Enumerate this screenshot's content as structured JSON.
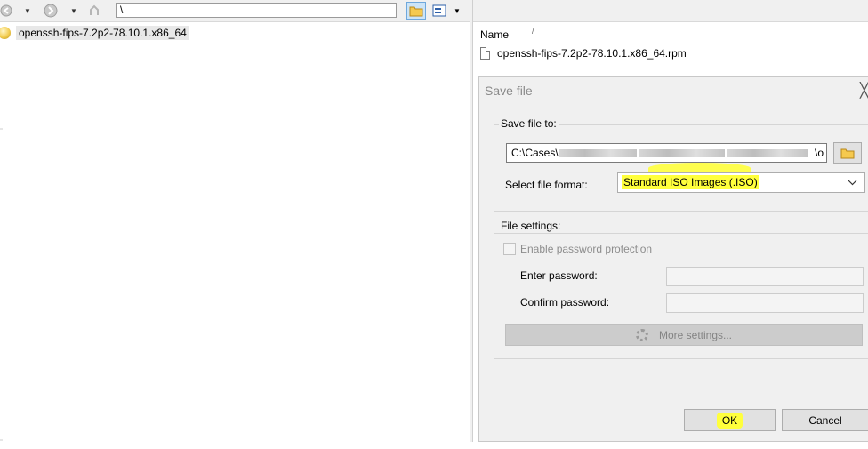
{
  "toolbar": {
    "address": "\\",
    "icons": [
      "back-icon",
      "forward-icon",
      "parent-folder-icon",
      "folder-icon",
      "view-icon"
    ]
  },
  "tree": {
    "items": [
      {
        "label": "openssh-fips-7.2p2-78.10.1.x86_64",
        "icon": "disc-icon"
      }
    ]
  },
  "file_list": {
    "column_name": "Name",
    "sort_indicator": "/",
    "rows": [
      {
        "name": "openssh-fips-7.2p2-78.10.1.x86_64.rpm"
      }
    ]
  },
  "dialog": {
    "title": "Save file",
    "close_glyph": "╳",
    "save_group_label": "Save file to:",
    "path_prefix": "C:\\Cases\\",
    "path_suffix": "\\o",
    "format_label": "Select file format:",
    "format_value": "Standard ISO Images (.ISO)",
    "settings_group_label": "File settings:",
    "enable_password_label": "Enable password protection",
    "enter_password_label": "Enter password:",
    "confirm_password_label": "Confirm password:",
    "more_settings_label": "More settings...",
    "ok_label": "OK",
    "cancel_label": "Cancel",
    "highlight_color": "#ffff3c"
  }
}
